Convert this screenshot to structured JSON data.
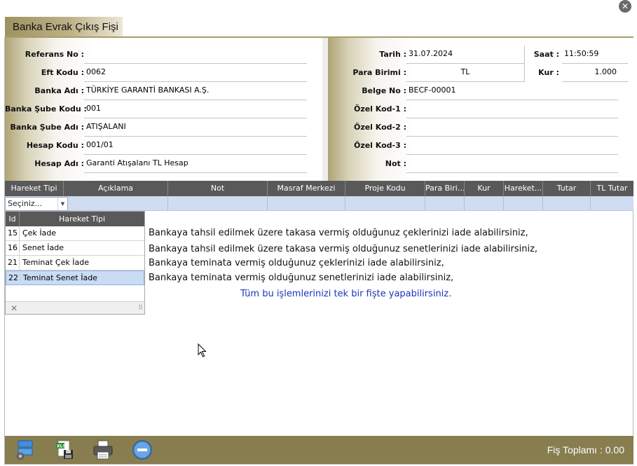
{
  "window": {
    "title": "Banka Evrak Çıkış Fişi",
    "close_glyph": "✕"
  },
  "left_fields": [
    {
      "label": "Referans No :",
      "value": ""
    },
    {
      "label": "Eft Kodu :",
      "value": "0062"
    },
    {
      "label": "Banka Adı :",
      "value": "TÜRKİYE GARANTİ BANKASI A.Ş."
    },
    {
      "label": "Banka Şube Kodu :",
      "value": "001"
    },
    {
      "label": "Banka Şube Adı :",
      "value": "ATIŞALANI"
    },
    {
      "label": "Hesap Kodu :",
      "value": "001/01"
    },
    {
      "label": "Hesap Adı :",
      "value": "Garanti Atışalanı TL Hesap"
    }
  ],
  "right_fields": {
    "tarih": {
      "label": "Tarih :",
      "value": "31.07.2024"
    },
    "saat": {
      "label": "Saat :",
      "value": "11:50:59"
    },
    "para_birimi": {
      "label": "Para Birimi :",
      "value": "TL"
    },
    "kur": {
      "label": "Kur :",
      "value": "1.000"
    },
    "belge_no": {
      "label": "Belge No :",
      "value": "BECF-00001"
    },
    "ozel_kod_1": {
      "label": "Özel Kod-1 :",
      "value": ""
    },
    "ozel_kod_2": {
      "label": "Özel Kod-2 :",
      "value": ""
    },
    "ozel_kod_3": {
      "label": "Özel Kod-3 :",
      "value": ""
    },
    "not": {
      "label": "Not :",
      "value": ""
    }
  },
  "grid": {
    "columns": [
      "Hareket Tipi",
      "Açıklama",
      "Not",
      "Masraf Merkezi",
      "Proje Kodu",
      "Para Biri...",
      "Kur",
      "Hareket...",
      "Tutar",
      "TL Tutar"
    ],
    "filter_placeholder": "Seçiniz..."
  },
  "dropdown": {
    "header_id": "Id",
    "header_name": "Hareket Tipi",
    "items": [
      {
        "id": "15",
        "name": "Çek İade"
      },
      {
        "id": "16",
        "name": "Senet İade"
      },
      {
        "id": "21",
        "name": "Teminat Çek İade"
      },
      {
        "id": "22",
        "name": "Teminat Senet İade"
      }
    ],
    "selected_id": "22"
  },
  "info": {
    "lines": [
      "Bankaya tahsil edilmek üzere takasa vermiş olduğunuz çeklerinizi iade alabilirsiniz,",
      "Bankaya tahsil edilmek üzere takasa vermiş olduğunuz senetlerinizi iade alabilirsiniz,",
      "Bankaya teminata vermiş olduğunuz çeklerinizi iade alabilirsiniz,",
      "Bankaya teminata vermiş olduğunuz senetlerinizi iade alabilirsiniz,"
    ],
    "summary": "Tüm bu işlemlerinizi tek bir fişte yapabilirsiniz."
  },
  "footer": {
    "icons": [
      "settings-icon",
      "excel-export-icon",
      "print-icon",
      "remove-icon"
    ],
    "total_label": "Fiş Toplamı : 0.00"
  },
  "colors": {
    "accent": "#877d4f",
    "grid_header": "#595959",
    "selection": "#c9dbf5",
    "info_blue": "#1b36b8"
  }
}
